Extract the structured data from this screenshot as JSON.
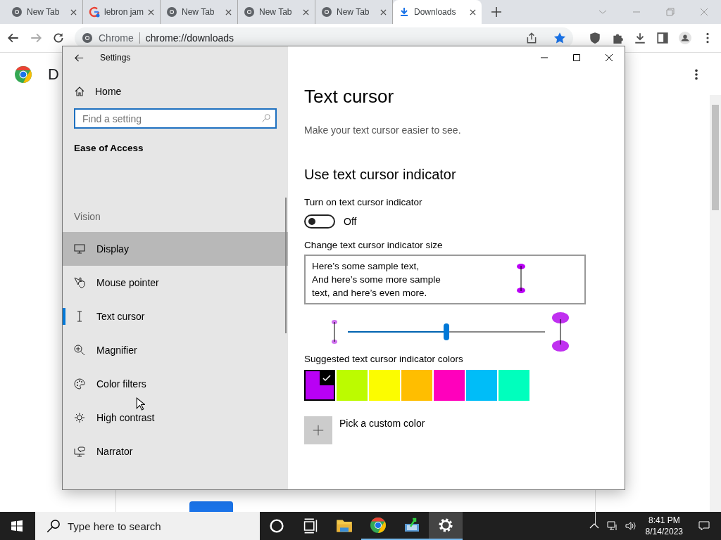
{
  "browser": {
    "tabs": [
      {
        "title": "New Tab",
        "kind": "chrome",
        "selected": false
      },
      {
        "title": "lebron jam",
        "kind": "google",
        "selected": false
      },
      {
        "title": "New Tab",
        "kind": "chrome",
        "selected": false
      },
      {
        "title": "New Tab",
        "kind": "chrome",
        "selected": false
      },
      {
        "title": "New Tab",
        "kind": "chrome",
        "selected": false
      },
      {
        "title": "Downloads",
        "kind": "download",
        "selected": true
      }
    ],
    "address": {
      "site_label": "Chrome",
      "url": "chrome://downloads"
    },
    "page": {
      "heading": "D"
    }
  },
  "settings": {
    "title": "Settings",
    "home": "Home",
    "search": {
      "placeholder": "Find a setting"
    },
    "section": "Ease of Access",
    "group": "Vision",
    "nav": [
      {
        "label": "Display",
        "kind": "display",
        "selected": false,
        "highlighted": true
      },
      {
        "label": "Mouse pointer",
        "kind": "pointer",
        "selected": false,
        "highlighted": false
      },
      {
        "label": "Text cursor",
        "kind": "cursor",
        "selected": true,
        "highlighted": false
      },
      {
        "label": "Magnifier",
        "kind": "magnifier",
        "selected": false,
        "highlighted": false
      },
      {
        "label": "Color filters",
        "kind": "palette",
        "selected": false,
        "highlighted": false
      },
      {
        "label": "High contrast",
        "kind": "sun",
        "selected": false,
        "highlighted": false
      },
      {
        "label": "Narrator",
        "kind": "narrator",
        "selected": false,
        "highlighted": false
      }
    ],
    "content": {
      "heading": "Text cursor",
      "description": "Make your text cursor easier to see.",
      "subheading": "Use text cursor indicator",
      "toggle": {
        "label": "Turn on text cursor indicator",
        "on": false,
        "state_text": "Off"
      },
      "size": {
        "label": "Change text cursor indicator size",
        "sample_lines": [
          "Here’s some sample text,",
          "And here’s some more sample",
          "text, and here’s even more."
        ],
        "level": 0.5
      },
      "colors_label": "Suggested text cursor indicator colors",
      "swatches": [
        {
          "color": "#b900f5",
          "selected": true
        },
        {
          "color": "#bcfb00",
          "selected": false
        },
        {
          "color": "#fcfc00",
          "selected": false
        },
        {
          "color": "#ffbe00",
          "selected": false
        },
        {
          "color": "#ff00bc",
          "selected": false
        },
        {
          "color": "#00bdf8",
          "selected": false
        },
        {
          "color": "#00ffbd",
          "selected": false
        }
      ],
      "custom_color": "Pick a custom color"
    }
  },
  "taskbar": {
    "search_placeholder": "Type here to search",
    "apps": [
      {
        "kind": "cortana",
        "running": false,
        "active": false
      },
      {
        "kind": "taskview",
        "running": false,
        "active": false
      },
      {
        "kind": "explorer",
        "running": false,
        "active": false
      },
      {
        "kind": "chrome",
        "running": true,
        "active": false
      },
      {
        "kind": "app",
        "running": true,
        "active": false
      },
      {
        "kind": "settings",
        "running": true,
        "active": true
      }
    ],
    "time": "8:41 PM",
    "date": "8/14/2023"
  }
}
